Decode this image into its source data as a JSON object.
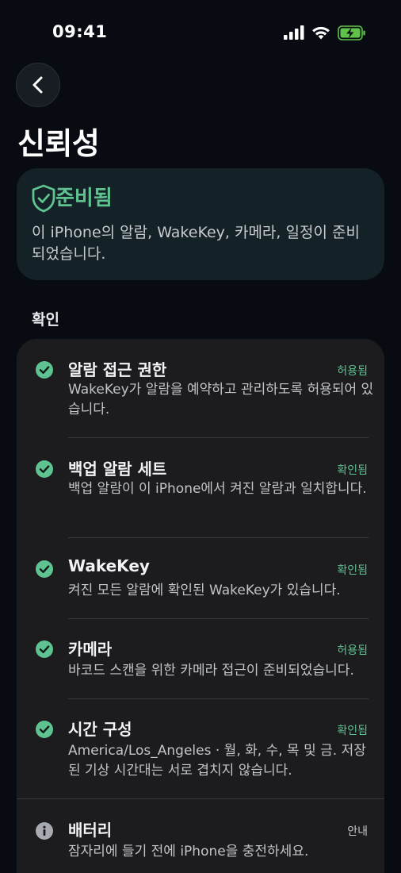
{
  "status_bar": {
    "time": "09:41"
  },
  "header": {
    "title": "신뢰성"
  },
  "ready_card": {
    "title": "준비됨",
    "description": "이 iPhone의 알람, WakeKey, 카메라, 일정이 준비되었습니다."
  },
  "checks": {
    "section_label": "확인",
    "items": [
      {
        "title": "알람 접근 권한",
        "status": "허용됨",
        "description": "WakeKey가 알람을 예약하고 관리하도록 허용되어 있습니다.",
        "icon": "check-circle-icon"
      },
      {
        "title": "백업 알람 세트",
        "status": "확인됨",
        "description": "백업 알람이 이 iPhone에서 켜진 알람과 일치합니다.",
        "icon": "check-circle-icon"
      },
      {
        "title": "WakeKey",
        "status": "확인됨",
        "description": "켜진 모든 알람에 확인된 WakeKey가 있습니다.",
        "icon": "check-circle-icon"
      },
      {
        "title": "카메라",
        "status": "허용됨",
        "description": "바코드 스캔을 위한 카메라 접근이 준비되었습니다.",
        "icon": "check-circle-icon"
      },
      {
        "title": "시간 구성",
        "status": "확인됨",
        "description": "America/Los_Angeles · 월, 화, 수, 목 및 금. 저장된 기상 시간대는 서로 겹치지 않습니다.",
        "icon": "check-circle-icon"
      },
      {
        "title": "배터리",
        "status": "안내",
        "description": "잠자리에 들기 전에 iPhone을 충전하세요.",
        "icon": "info-circle-icon"
      }
    ]
  },
  "colors": {
    "accent_green": "#5fc291",
    "background": "#080c12",
    "card": "#1c1c1f"
  }
}
